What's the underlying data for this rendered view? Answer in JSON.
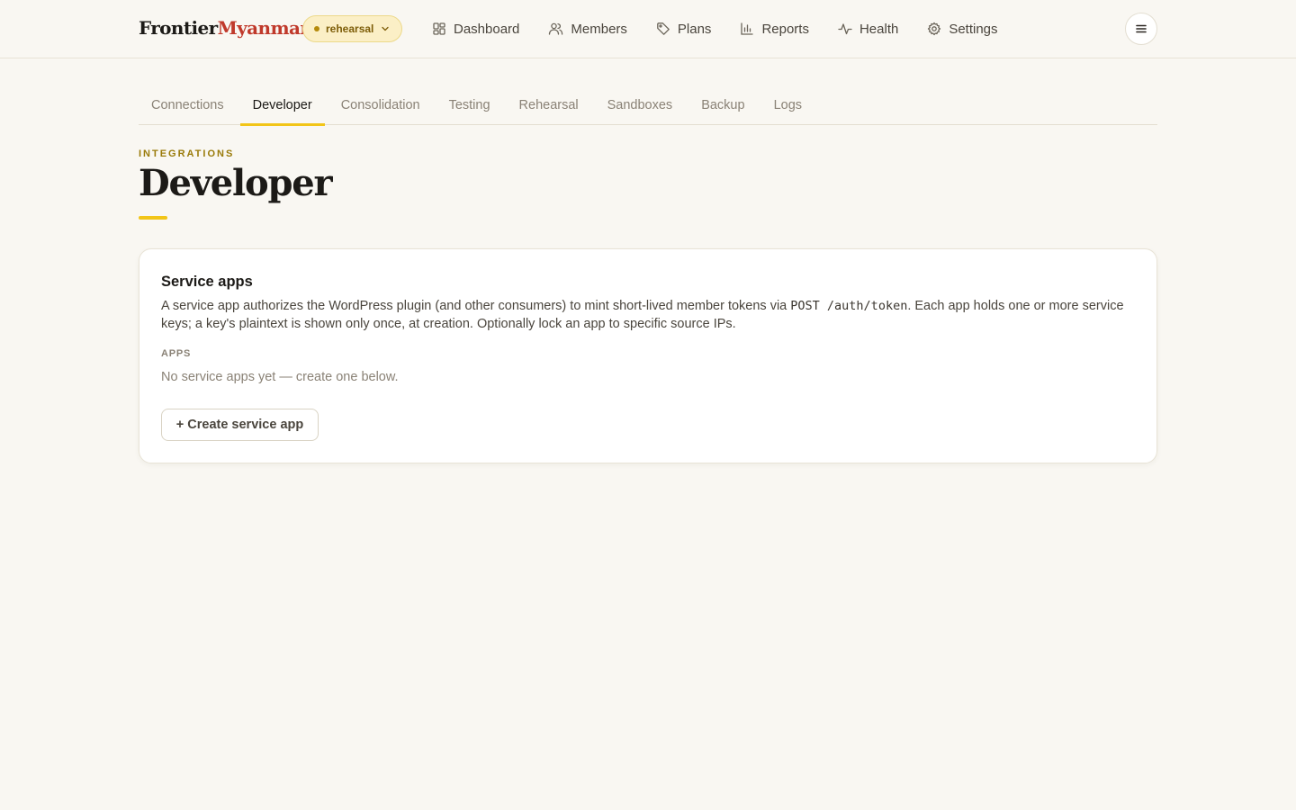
{
  "header": {
    "logo_part1": "Frontier",
    "logo_part2": "Myanmar",
    "env_label": "rehearsal",
    "nav": [
      {
        "label": "Dashboard",
        "icon": "dashboard-icon"
      },
      {
        "label": "Members",
        "icon": "users-icon"
      },
      {
        "label": "Plans",
        "icon": "tag-icon"
      },
      {
        "label": "Reports",
        "icon": "bar-chart-icon"
      },
      {
        "label": "Health",
        "icon": "activity-icon"
      },
      {
        "label": "Settings",
        "icon": "gear-icon"
      }
    ],
    "menu_icon": "hamburger-menu-icon"
  },
  "subtabs": {
    "items": [
      "Connections",
      "Developer",
      "Consolidation",
      "Testing",
      "Rehearsal",
      "Sandboxes",
      "Backup",
      "Logs"
    ],
    "active": "Developer"
  },
  "page": {
    "eyebrow": "INTEGRATIONS",
    "title": "Developer"
  },
  "card": {
    "title": "Service apps",
    "desc_before": "A service app authorizes the WordPress plugin (and other consumers) to mint short-lived member tokens via ",
    "desc_code": "POST /auth/token",
    "desc_after": ". Each app holds one or more service keys; a key's plaintext is shown only once, at creation. Optionally lock an app to specific source IPs.",
    "apps_label": "APPS",
    "empty_text": "No service apps yet — create one below.",
    "create_button": "+ Create service app"
  },
  "colors": {
    "accent": "#f2c518",
    "brand_red": "#c0392b",
    "background": "#f9f7f2"
  }
}
